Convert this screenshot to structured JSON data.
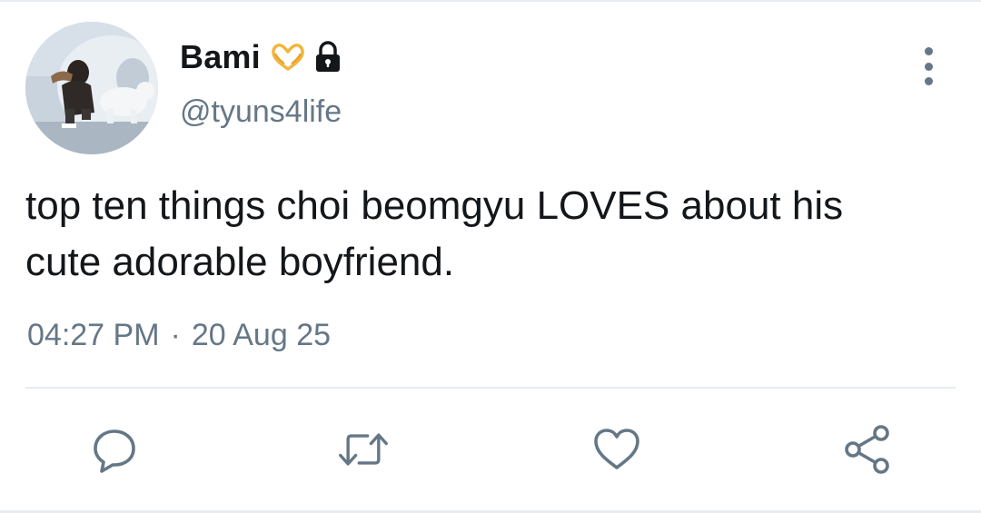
{
  "author": {
    "display_name": "Bami",
    "handle": "@tyuns4life",
    "badges": [
      "heart-hands-emoji",
      "lock-icon"
    ]
  },
  "tweet": {
    "text": "top ten things choi beomgyu LOVES about his\ncute adorable boyfriend."
  },
  "meta": {
    "time": "04:27 PM",
    "separator": "·",
    "date": "20 Aug 25"
  },
  "actions": [
    "reply-icon",
    "retweet-icon",
    "like-icon",
    "share-icon"
  ],
  "colors": {
    "text_primary": "#14171a",
    "text_secondary": "#657786",
    "divider": "#e6ecf0",
    "icon": "#657786"
  }
}
